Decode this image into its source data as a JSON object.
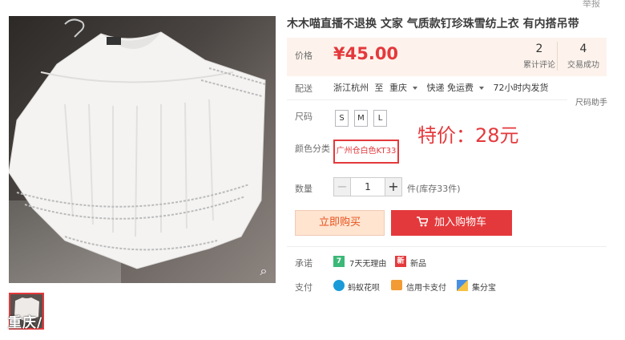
{
  "report": "举报",
  "product": {
    "title": "木木喵直播不退换 文家 气质款钉珍珠雪纺上衣 有内搭吊带",
    "thumbnail_caption": "重庆/"
  },
  "price": {
    "label": "价格",
    "value": "¥45.00"
  },
  "stats": [
    {
      "count": "2",
      "label": "累计评论"
    },
    {
      "count": "4",
      "label": "交易成功"
    }
  ],
  "shipping": {
    "label": "配送",
    "from": "浙江杭州",
    "to_word": "至",
    "to": "重庆",
    "method": "快递 免运费",
    "promise": "72小时内发货"
  },
  "size": {
    "label": "尺码",
    "helper": "尺码助手",
    "options": [
      "S",
      "M",
      "L"
    ]
  },
  "promo_text": "特价：28元",
  "color": {
    "label": "颜色分类",
    "selected": "广州仓白色KT33"
  },
  "quantity": {
    "label": "数量",
    "minus": "−",
    "value": "1",
    "plus": "+",
    "stock": "件(库存33件)"
  },
  "buttons": {
    "buy_now": "立即购买",
    "add_to_cart": "加入购物车"
  },
  "promise": {
    "label": "承诺",
    "items": [
      {
        "icon": "return-7day-icon",
        "badge": "7",
        "text": "7天无理由",
        "color": "#3cb878"
      },
      {
        "icon": "new-product-icon",
        "badge": "新",
        "text": "新品",
        "color": "#e4393c"
      }
    ]
  },
  "payment": {
    "label": "支付",
    "items": [
      {
        "icon": "huabei-icon",
        "text": "蚂蚁花呗",
        "color": "#1a9bd8"
      },
      {
        "icon": "credit-card-icon",
        "text": "信用卡支付",
        "color": "#f29b35"
      },
      {
        "icon": "jifenbao-icon",
        "text": "集分宝",
        "color": "#4a90e2"
      }
    ]
  },
  "colors": {
    "accent": "#e4393c",
    "price_bg": "#fdf3ec",
    "buy_bg": "#ffe4d0"
  }
}
